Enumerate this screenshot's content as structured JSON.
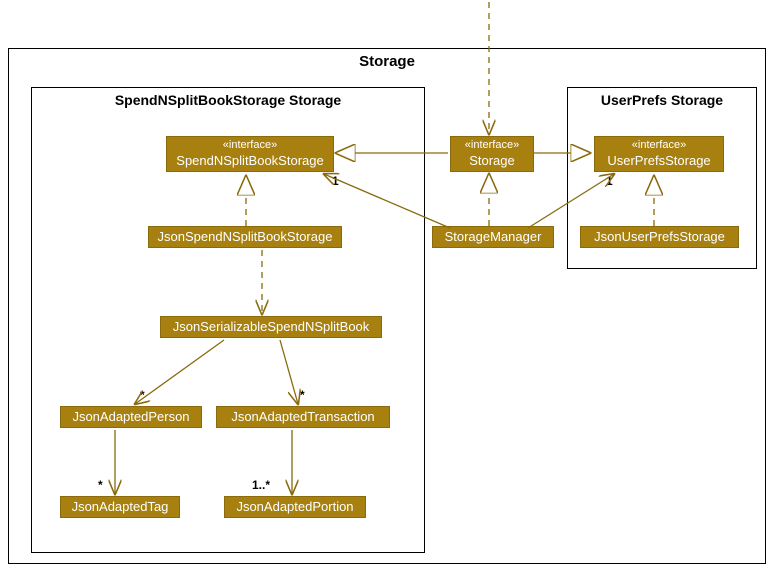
{
  "package": {
    "title": "Storage",
    "left": {
      "title": "SpendNSplitBookStorage Storage"
    },
    "right": {
      "title": "UserPrefs Storage"
    }
  },
  "classes": {
    "spendNSplitBookStorage": {
      "stereo": "«interface»",
      "name": "SpendNSplitBookStorage"
    },
    "storage": {
      "stereo": "«interface»",
      "name": "Storage"
    },
    "userPrefsStorage": {
      "stereo": "«interface»",
      "name": "UserPrefsStorage"
    },
    "jsonSpendNSplitBookStorage": {
      "name": "JsonSpendNSplitBookStorage"
    },
    "storageManager": {
      "name": "StorageManager"
    },
    "jsonUserPrefsStorage": {
      "name": "JsonUserPrefsStorage"
    },
    "jsonSerializable": {
      "name": "JsonSerializableSpendNSplitBook"
    },
    "jsonAdaptedPerson": {
      "name": "JsonAdaptedPerson"
    },
    "jsonAdaptedTransaction": {
      "name": "JsonAdaptedTransaction"
    },
    "jsonAdaptedTag": {
      "name": "JsonAdaptedTag"
    },
    "jsonAdaptedPortion": {
      "name": "JsonAdaptedPortion"
    }
  },
  "multiplicities": {
    "one_a": "1",
    "one_b": "1",
    "star_a": "*",
    "star_b": "*",
    "star_c": "*",
    "one_star": "1..*"
  }
}
